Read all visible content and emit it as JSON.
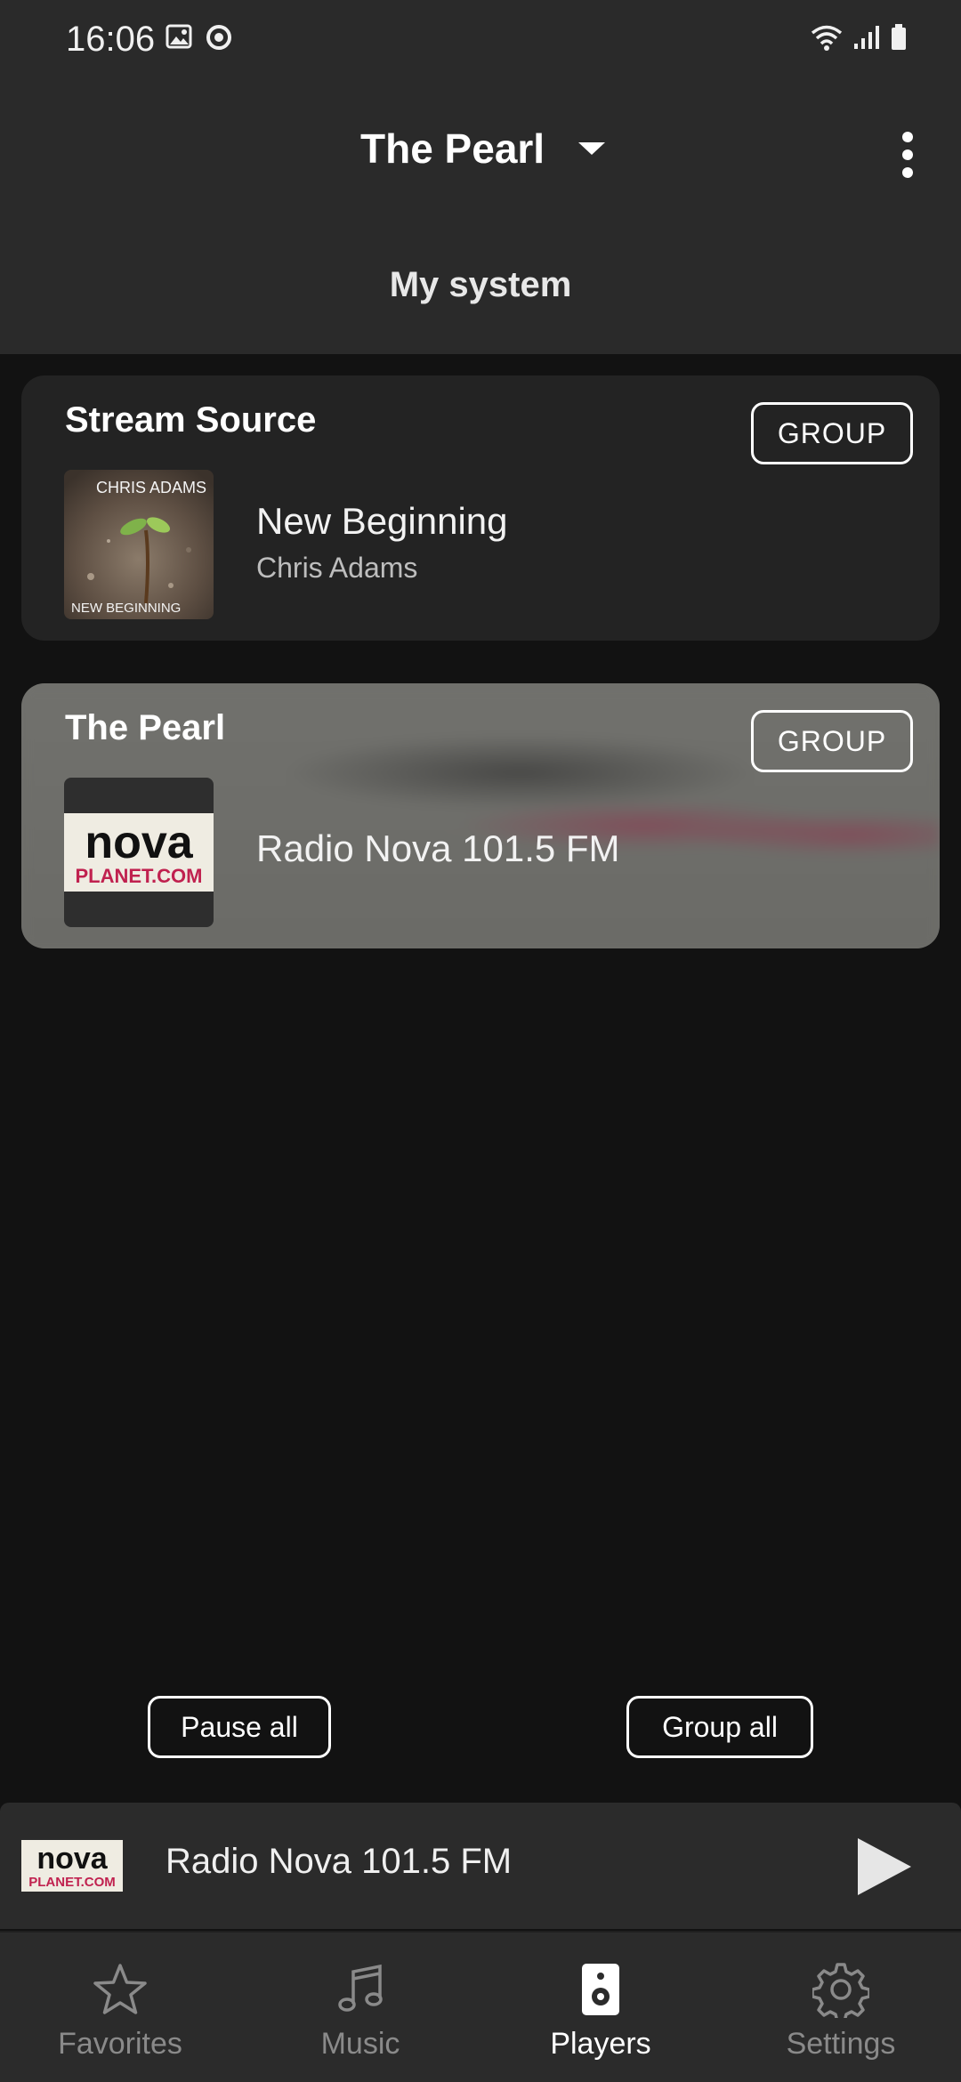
{
  "status_bar": {
    "time": "16:06"
  },
  "header": {
    "title": "The Pearl",
    "subtitle": "My system"
  },
  "cards": [
    {
      "title": "Stream Source",
      "group_label": "GROUP",
      "track_title": "New Beginning",
      "track_artist": "Chris Adams",
      "art_text_top": "CHRIS ADAMS",
      "art_text_bottom": "NEW BEGINNING"
    },
    {
      "title": "The Pearl",
      "group_label": "GROUP",
      "track_title": "Radio Nova 101.5 FM",
      "art_text_top": "nova",
      "art_text_bottom": "PLANET.COM"
    }
  ],
  "actions": {
    "pause_all": "Pause all",
    "group_all": "Group all"
  },
  "mini_player": {
    "title": "Radio Nova 101.5 FM",
    "art_text_top": "nova",
    "art_text_bottom": "PLANET.COM"
  },
  "nav": {
    "items": [
      {
        "label": "Favorites",
        "icon": "star-icon"
      },
      {
        "label": "Music",
        "icon": "music-note-icon"
      },
      {
        "label": "Players",
        "icon": "speaker-icon",
        "active": true
      },
      {
        "label": "Settings",
        "icon": "gear-icon"
      }
    ]
  },
  "colors": {
    "background": "#121212",
    "header": "#2a2a2a",
    "card": "#232323",
    "active_card": "#6f6f6b",
    "accent_red": "#c0214f"
  }
}
